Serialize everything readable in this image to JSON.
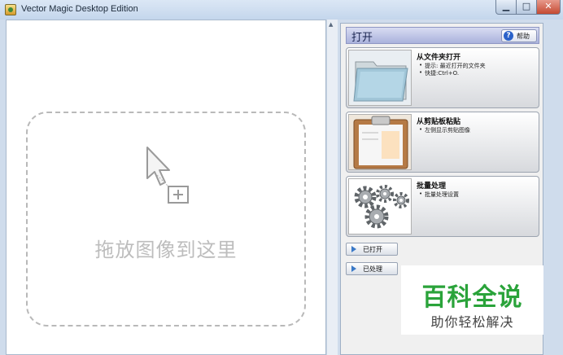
{
  "window": {
    "title": "Vector Magic Desktop Edition",
    "min_glyph": "▁",
    "max_glyph": "□",
    "close_glyph": "✕"
  },
  "canvas": {
    "drop_text": "拖放图像到这里"
  },
  "panel": {
    "title": "打开",
    "help_label": "帮助",
    "help_icon_glyph": "?",
    "cards": [
      {
        "title": "从文件夹打开",
        "lines": [
          "提示: 最近打开的文件夹",
          "快捷:Ctrl+O."
        ],
        "icon": "folder-icon"
      },
      {
        "title": "从剪贴板粘贴",
        "lines": [
          "左侧显示剪贴图像"
        ],
        "icon": "clipboard-icon"
      },
      {
        "title": "批量处理",
        "lines": [
          "批量处理设置"
        ],
        "icon": "gears-icon"
      }
    ],
    "buttons": [
      {
        "label": "已打开"
      },
      {
        "label": "已处理"
      }
    ]
  },
  "watermark": {
    "main": "百科全说",
    "sub": "助你轻松解决"
  },
  "colors": {
    "accent": "#3a79c7",
    "watermark_green": "#2aa33a"
  }
}
